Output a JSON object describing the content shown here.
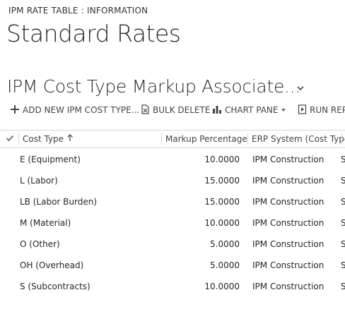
{
  "breadcrumb": "IPM RATE TABLE : INFORMATION",
  "page_title": "Standard Rates",
  "view": {
    "title": "IPM Cost Type Markup Associate...",
    "chevron_icon": "chevron-down-icon"
  },
  "toolbar": {
    "add_label": "ADD NEW IPM COST TYPE...",
    "bulk_delete_label": "BULK DELETE",
    "chart_pane_label": "CHART PANE",
    "run_report_label": "RUN REPO"
  },
  "grid": {
    "columns": {
      "cost_type": "Cost Type",
      "markup_percentage": "Markup Percentage",
      "erp_system": "ERP System (Cost Type)"
    },
    "rows": [
      {
        "cost_type": "E (Equipment)",
        "markup": "10.0000",
        "erp": "IPM Construction",
        "extra": "S"
      },
      {
        "cost_type": "L (Labor)",
        "markup": "15.0000",
        "erp": "IPM Construction",
        "extra": "S"
      },
      {
        "cost_type": "LB (Labor Burden)",
        "markup": "15.0000",
        "erp": "IPM Construction",
        "extra": "S"
      },
      {
        "cost_type": "M (Material)",
        "markup": "10.0000",
        "erp": "IPM Construction",
        "extra": "S"
      },
      {
        "cost_type": "O (Other)",
        "markup": "5.0000",
        "erp": "IPM Construction",
        "extra": "S"
      },
      {
        "cost_type": "OH (Overhead)",
        "markup": "5.0000",
        "erp": "IPM Construction",
        "extra": "S"
      },
      {
        "cost_type": "S (Subcontracts)",
        "markup": "10.0000",
        "erp": "IPM Construction",
        "extra": "S"
      }
    ]
  }
}
